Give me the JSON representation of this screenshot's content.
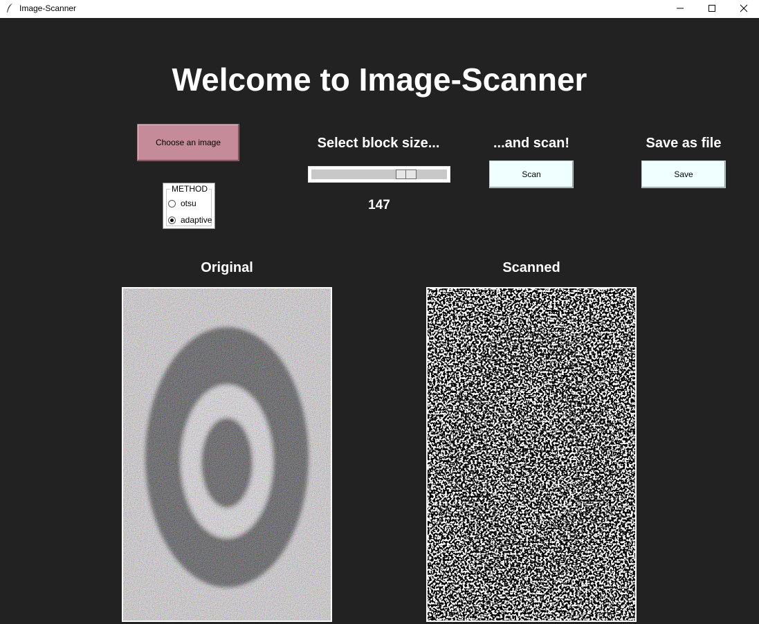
{
  "window": {
    "title": "Image-Scanner",
    "icons": [
      "feather-icon",
      "minimize-icon",
      "maximize-icon",
      "close-icon"
    ]
  },
  "main": {
    "heading": "Welcome to Image-Scanner",
    "choose_button": "Choose an image",
    "method": {
      "legend": "METHOD",
      "options": [
        "otsu",
        "adaptive"
      ],
      "selected": "adaptive"
    },
    "block_size": {
      "label": "Select block size...",
      "value": "147"
    },
    "scan": {
      "label": "...and scan!",
      "button": "Scan"
    },
    "save": {
      "label": "Save as file",
      "button": "Save"
    },
    "original_label": "Original",
    "scanned_label": "Scanned"
  },
  "colors": {
    "background": "#222222",
    "choose_button": "#c58b98",
    "action_buttons": "#f0ffff"
  }
}
